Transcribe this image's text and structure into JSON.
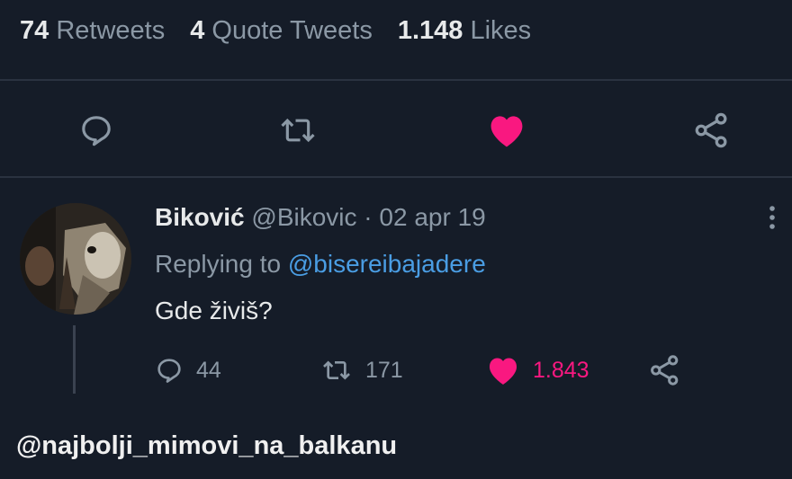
{
  "stats": {
    "retweets_count": "74",
    "retweets_label": "Retweets",
    "quotes_count": "4",
    "quotes_label": "Quote Tweets",
    "likes_count": "1.148",
    "likes_label": "Likes"
  },
  "main_actions": {
    "icons": [
      "comment-icon",
      "retweet-icon",
      "heart-icon-filled",
      "share-icon"
    ],
    "liked": true
  },
  "reply": {
    "display_name": "Biković",
    "handle": "@Bikovic",
    "separator": "·",
    "date": "02 apr 19",
    "replying_prefix": "Replying to",
    "replying_to": "@bisereibajadere",
    "text": "Gde živiš?",
    "comments": "44",
    "retweets": "171",
    "likes": "1.843",
    "liked": true
  },
  "watermark": "@najbolji_mimovi_na_balkanu",
  "colors": {
    "background": "#151c28",
    "like_pink": "#f91880",
    "link_blue": "#4a9de3",
    "muted": "#8b98a5"
  }
}
